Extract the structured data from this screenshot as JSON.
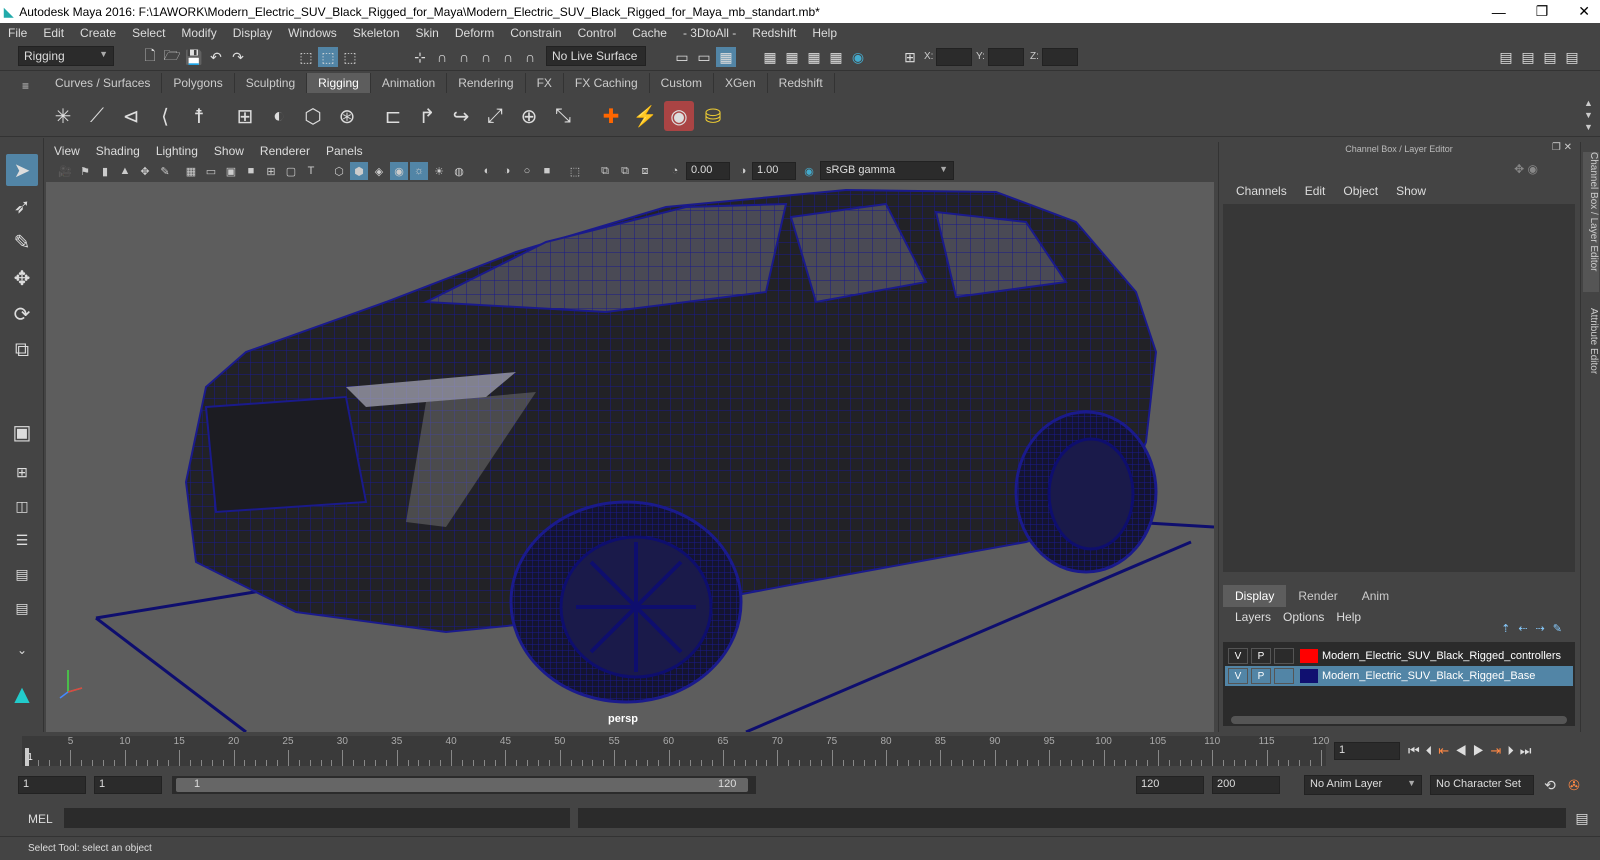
{
  "window": {
    "title": "Autodesk Maya 2016: F:\\1AWORK\\Modern_Electric_SUV_Black_Rigged_for_Maya\\Modern_Electric_SUV_Black_Rigged_for_Maya_mb_standart.mb*",
    "minimize": "—",
    "restore": "❐",
    "close": "✕"
  },
  "menubar": [
    "File",
    "Edit",
    "Create",
    "Select",
    "Modify",
    "Display",
    "Windows",
    "Skeleton",
    "Skin",
    "Deform",
    "Constrain",
    "Control",
    "Cache",
    "- 3DtoAll -",
    "Redshift",
    "Help"
  ],
  "statusline": {
    "mode": "Rigging",
    "live_surface": "No Live Surface",
    "x_label": "X:",
    "y_label": "Y:",
    "z_label": "Z:"
  },
  "shelf_tabs": [
    "Curves / Surfaces",
    "Polygons",
    "Sculpting",
    "Rigging",
    "Animation",
    "Rendering",
    "FX",
    "FX Caching",
    "Custom",
    "XGen",
    "Redshift"
  ],
  "shelf_active": "Rigging",
  "panel_menu": [
    "View",
    "Shading",
    "Lighting",
    "Show",
    "Renderer",
    "Panels"
  ],
  "panel_tools": {
    "exposure": "0.00",
    "gamma": "1.00",
    "color_space": "sRGB gamma"
  },
  "viewport": {
    "camera": "persp",
    "wire_color": "#1a1a8c"
  },
  "channel_box": {
    "title": "Channel Box / Layer Editor",
    "menu": [
      "Channels",
      "Edit",
      "Object",
      "Show"
    ]
  },
  "layer_editor": {
    "tabs": [
      "Display",
      "Render",
      "Anim"
    ],
    "menu": [
      "Layers",
      "Options",
      "Help"
    ],
    "layers": [
      {
        "v": "V",
        "p": "P",
        "color": "#ff0000",
        "name": "Modern_Electric_SUV_Black_Rigged_controllers",
        "selected": false
      },
      {
        "v": "V",
        "p": "P",
        "color": "#101070",
        "name": "Modern_Electric_SUV_Black_Rigged_Base",
        "selected": true
      }
    ]
  },
  "side_tabs": [
    "Channel Box / Layer Editor",
    "Attribute Editor"
  ],
  "time_slider": {
    "ticks": [
      "5",
      "10",
      "15",
      "20",
      "25",
      "30",
      "35",
      "40",
      "45",
      "50",
      "55",
      "60",
      "65",
      "70",
      "75",
      "80",
      "85",
      "90",
      "95",
      "100",
      "105",
      "110",
      "115",
      "120"
    ],
    "current_frame": "1",
    "first_label": "1"
  },
  "range_slider": {
    "start": "1",
    "start2": "1",
    "range_start": "1",
    "range_end": "120",
    "end": "120",
    "end2": "200",
    "anim_layer": "No Anim Layer",
    "character_set": "No Character Set"
  },
  "command_line": {
    "label": "MEL"
  },
  "help_line": "Select Tool: select an object"
}
